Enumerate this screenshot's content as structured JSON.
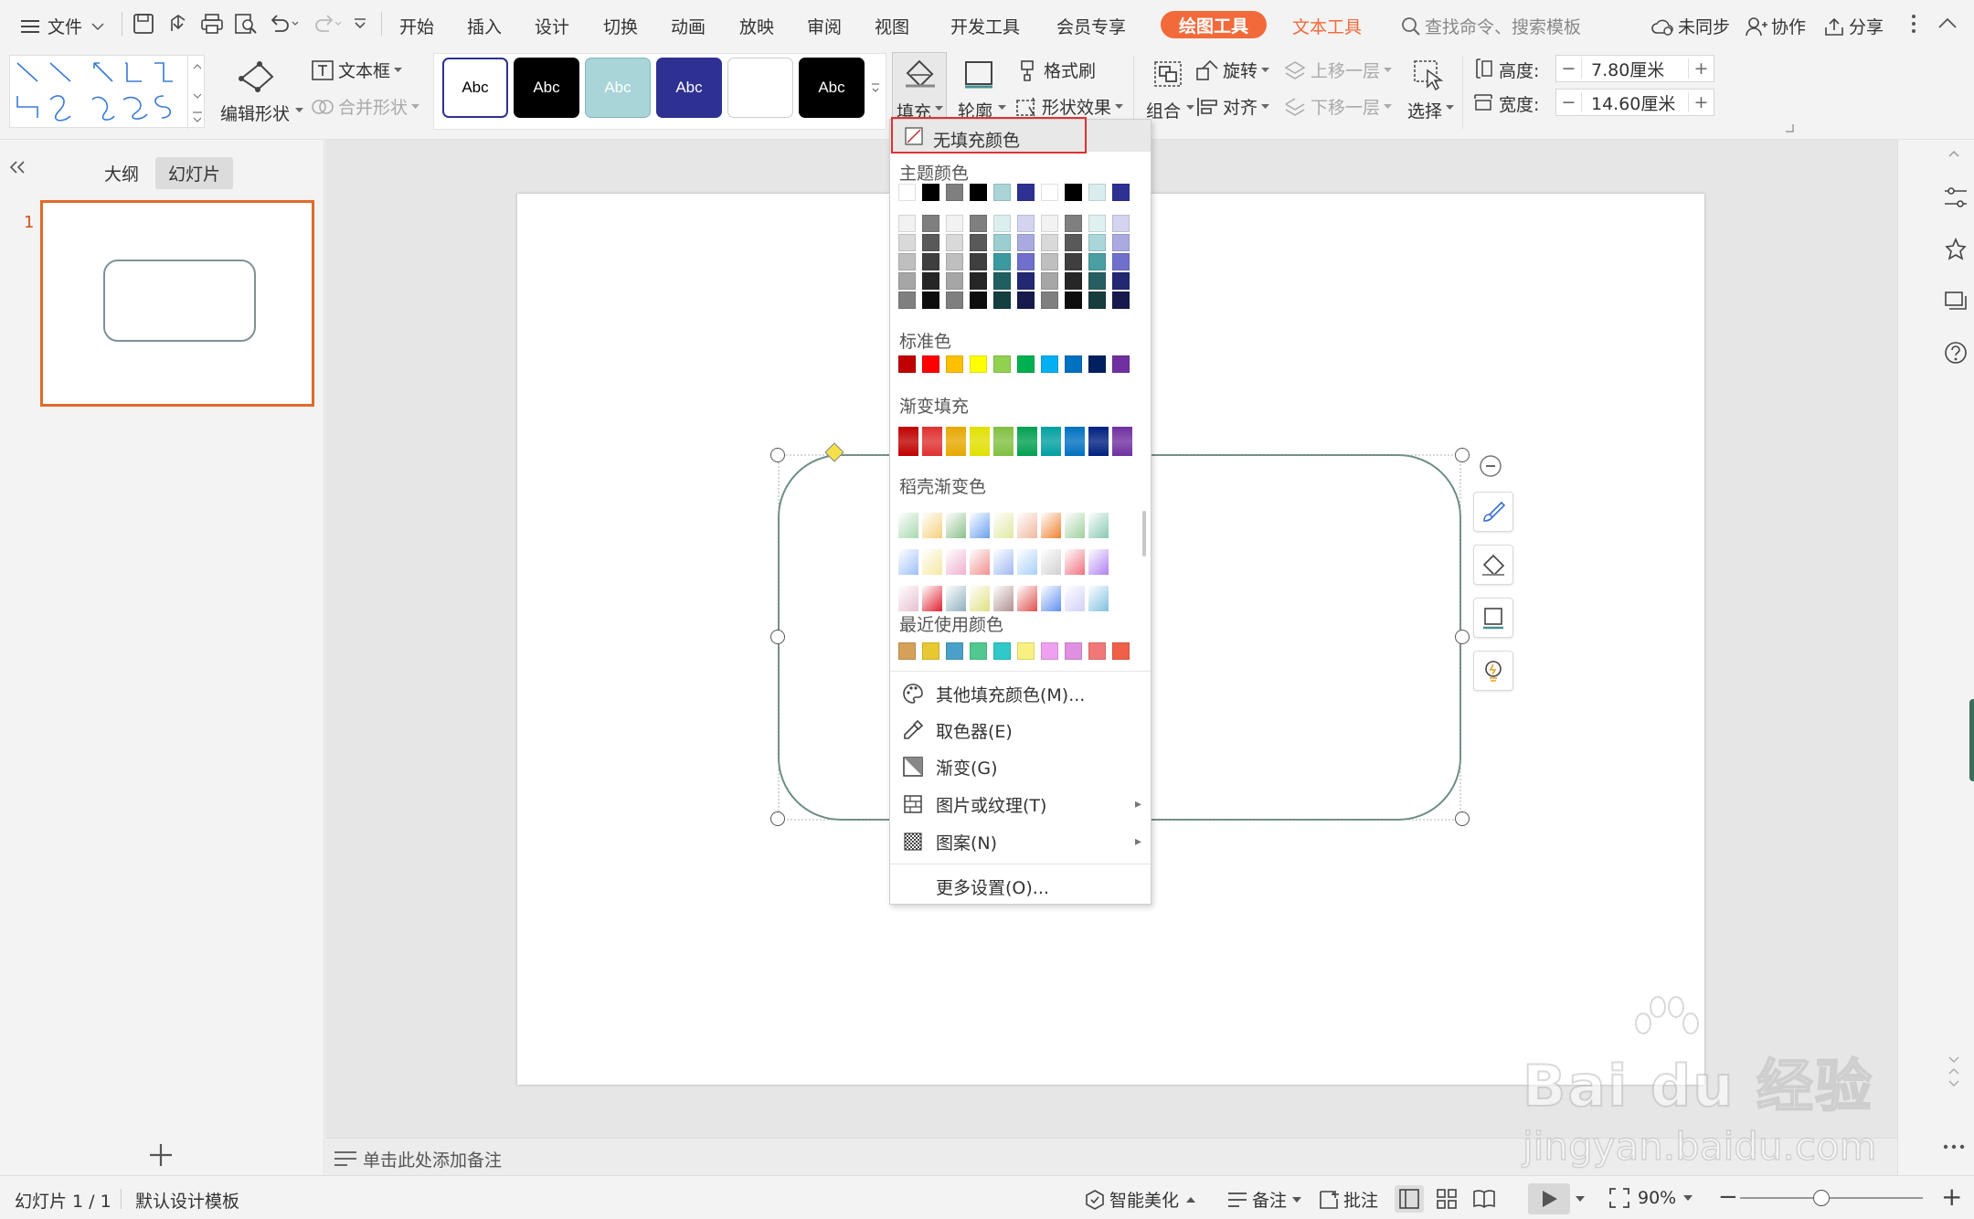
{
  "menubar": {
    "file": "文件",
    "tabs": [
      "开始",
      "插入",
      "设计",
      "切换",
      "动画",
      "放映",
      "审阅",
      "视图",
      "开发工具",
      "会员专享"
    ],
    "drawing_tools": "绘图工具",
    "text_tools": "文本工具",
    "search_placeholder": "查找命令、搜索模板",
    "sync": "未同步",
    "collab": "协作",
    "share": "分享"
  },
  "ribbon": {
    "edit_shape": "编辑形状",
    "text_box": "文本框",
    "merge_shape": "合并形状",
    "style_sample": "Abc",
    "fill": "填充",
    "outline": "轮廓",
    "format_brush": "格式刷",
    "shape_effect": "形状效果",
    "group": "组合",
    "rotate": "旋转",
    "align": "对齐",
    "bring_forward": "上移一层",
    "send_backward": "下移一层",
    "select": "选择",
    "height_label": "高度:",
    "height_value": "7.80厘米",
    "width_label": "宽度:",
    "width_value": "14.60厘米",
    "minus": "−",
    "plus": "+"
  },
  "left_panel": {
    "tab_outline": "大纲",
    "tab_slides": "幻灯片",
    "slide_number": "1"
  },
  "dropdown": {
    "no_fill": "无填充颜色",
    "theme_colors": "主题颜色",
    "standard_colors": "标准色",
    "gradient_fill": "渐变填充",
    "docer_gradient": "稻壳渐变色",
    "recent_colors": "最近使用颜色",
    "other_fill": "其他填充颜色(M)...",
    "eyedropper": "取色器(E)",
    "gradient": "渐变(G)",
    "picture_texture": "图片或纹理(T)",
    "pattern": "图案(N)",
    "more_settings": "更多设置(O)...",
    "theme_top": [
      "#ffffff",
      "#000000",
      "#7f7f7f",
      "#000000",
      "#a9d5d9",
      "#2e3192",
      "#ffffff",
      "#000000",
      "#d9ecee",
      "#2e3192"
    ],
    "theme_rows": [
      [
        "#f2f2f2",
        "#7f7f7f",
        "#f2f2f2",
        "#7f7f7f",
        "#dcefef",
        "#d4d4f0",
        "#f2f2f2",
        "#7f7f7f",
        "#dff0f0",
        "#d4d4f0"
      ],
      [
        "#d9d9d9",
        "#595959",
        "#d9d9d9",
        "#595959",
        "#9ccdd0",
        "#aaaae0",
        "#d9d9d9",
        "#595959",
        "#a8d6d9",
        "#aaaae0"
      ],
      [
        "#bfbfbf",
        "#3f3f3f",
        "#bfbfbf",
        "#3f3f3f",
        "#3b9a9f",
        "#7070cc",
        "#bfbfbf",
        "#3f3f3f",
        "#4a9fa3",
        "#7070cc"
      ],
      [
        "#a6a6a6",
        "#262626",
        "#a6a6a6",
        "#262626",
        "#1f5f62",
        "#232872",
        "#a6a6a6",
        "#262626",
        "#275e61",
        "#232872"
      ],
      [
        "#7f7f7f",
        "#0d0d0d",
        "#7f7f7f",
        "#0d0d0d",
        "#143f41",
        "#171a4c",
        "#7f7f7f",
        "#0d0d0d",
        "#173c3e",
        "#171a4c"
      ]
    ],
    "standard": [
      "#c00000",
      "#ff0000",
      "#ffc000",
      "#ffff00",
      "#92d050",
      "#00b050",
      "#00b0f0",
      "#0070c0",
      "#002060",
      "#7030a0"
    ],
    "gradients": [
      "#c00000",
      "#e03030",
      "#e6a800",
      "#e0e000",
      "#80c040",
      "#00a050",
      "#00a0a0",
      "#0070c0",
      "#002080",
      "#7030a0"
    ],
    "docer": [
      [
        "#a8d8b0",
        "#f5d07a",
        "#8cc08c",
        "#6aa0f0",
        "#e0e8a0",
        "#f0b8a0",
        "#f08030",
        "#a0d0a0",
        "#88c8b0"
      ],
      [
        "#a0c0f8",
        "#f5e8a0",
        "#f0b0d0",
        "#f09090",
        "#a0b8f0",
        "#a8d0f8",
        "#d0d0d0",
        "#f07080",
        "#b080f0"
      ],
      [
        "#e8c0d0",
        "#e02030",
        "#90b0c0",
        "#e0e080",
        "#b09090",
        "#e05050",
        "#6090f0",
        "#d0d0f8",
        "#80c0e0"
      ]
    ],
    "recent": [
      "#d4a05a",
      "#e8c830",
      "#4aa0c8",
      "#50c890",
      "#30c8c8",
      "#f8f080",
      "#f0a0f0",
      "#e090e0",
      "#f07878",
      "#f06048"
    ]
  },
  "status": {
    "slide_info": "幻灯片 1 / 1",
    "template": "默认设计模板",
    "notes_hint": "单击此处添加备注",
    "smart_beautify": "智能美化",
    "notes": "备注",
    "comment": "批注",
    "zoom": "90%",
    "minus": "−",
    "plus": "+"
  },
  "watermark": {
    "brand": "Bai du 经验",
    "url": "jingyan.baidu.com"
  }
}
